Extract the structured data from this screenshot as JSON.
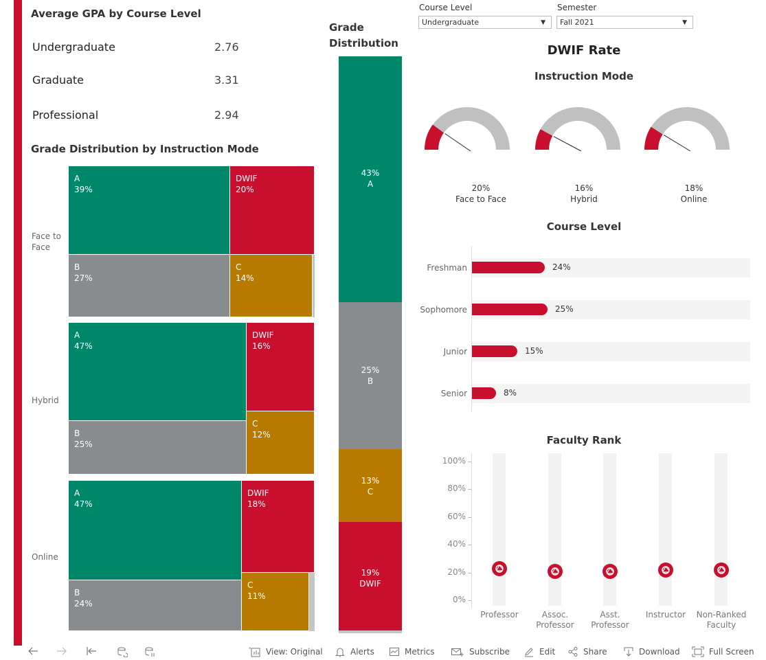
{
  "gpa_panel": {
    "title": "Average GPA by Course Level",
    "rows": [
      {
        "label": "Undergraduate",
        "value": "2.76"
      },
      {
        "label": "Graduate",
        "value": "3.31"
      },
      {
        "label": "Professional",
        "value": "2.94"
      }
    ]
  },
  "treemap": {
    "title": "Grade Distribution by Instruction Mode",
    "modes": [
      {
        "mode": "Face to Face",
        "A": 39,
        "B": 27,
        "C": 14,
        "DWIF": 20
      },
      {
        "mode": "Hybrid",
        "A": 47,
        "B": 25,
        "C": 12,
        "DWIF": 16
      },
      {
        "mode": "Online",
        "A": 47,
        "B": 24,
        "C": 11,
        "DWIF": 18
      }
    ],
    "labels": {
      "ftf": "Face to\nFace",
      "hybrid": "Hybrid",
      "online": "Online",
      "ftf_a": "A\n39%",
      "ftf_b": "B\n27%",
      "ftf_c": "C\n14%",
      "ftf_d": "DWIF\n20%",
      "hy_a": "A\n47%",
      "hy_b": "B\n25%",
      "hy_c": "C\n12%",
      "hy_d": "DWIF\n16%",
      "on_a": "A\n47%",
      "on_b": "B\n24%",
      "on_c": "C\n11%",
      "on_d": "DWIF\n18%"
    }
  },
  "grade_distribution": {
    "title": "Grade\nDistribution",
    "segments": [
      {
        "grade": "A",
        "value": 43,
        "label": "43%\nA"
      },
      {
        "grade": "B",
        "value": 25,
        "label": "25%\nB"
      },
      {
        "grade": "C",
        "value": 13,
        "label": "13%\nC"
      },
      {
        "grade": "DWIF",
        "value": 19,
        "label": "19%\nDWIF"
      }
    ]
  },
  "filters": {
    "course_level_label": "Course Level",
    "course_level_value": "Undergraduate",
    "semester_label": "Semester",
    "semester_value": "Fall 2021"
  },
  "dwif": {
    "title": "DWIF Rate",
    "instruction_title": "Instruction Mode",
    "gauges": [
      {
        "value": 0.2,
        "pct": "20%",
        "label": "Face to Face"
      },
      {
        "value": 0.16,
        "pct": "16%",
        "label": "Hybrid"
      },
      {
        "value": 0.18,
        "pct": "18%",
        "label": "Online"
      }
    ]
  },
  "course_level": {
    "title": "Course Level",
    "bars": [
      {
        "label": "Freshman",
        "value": 0.24,
        "text": "24%"
      },
      {
        "label": "Sophomore",
        "value": 0.25,
        "text": "25%"
      },
      {
        "label": "Junior",
        "value": 0.15,
        "text": "15%"
      },
      {
        "label": "Senior",
        "value": 0.08,
        "text": "8%"
      }
    ]
  },
  "faculty_rank": {
    "title": "Faculty Rank",
    "ticks": [
      "100%",
      "80%",
      "60%",
      "40%",
      "20%",
      "0%"
    ],
    "ranks": [
      {
        "label": "Professor",
        "value": 0.23
      },
      {
        "label": "Assoc.\nProfessor",
        "value": 0.21
      },
      {
        "label": "Asst.\nProfessor",
        "value": 0.21
      },
      {
        "label": "Instructor",
        "value": 0.22
      },
      {
        "label": "Non-Ranked\nFaculty",
        "value": 0.22
      }
    ]
  },
  "toolbar": {
    "view": "View: Original",
    "alerts": "Alerts",
    "metrics": "Metrics",
    "subscribe": "Subscribe",
    "edit": "Edit",
    "share": "Share",
    "download": "Download",
    "fullscreen": "Full Screen"
  },
  "colors": {
    "accent_red": "#c8102e",
    "green": "#00876a",
    "grey": "#898c8e",
    "gold": "#b97a00"
  }
}
